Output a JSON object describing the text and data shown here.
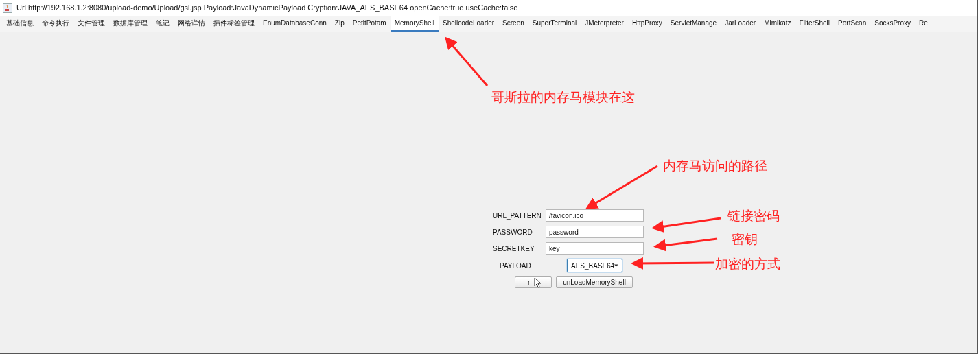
{
  "window": {
    "title": "Url:http://192.168.1.2:8080/upload-demo/Upload/gsl.jsp Payload:JavaDynamicPayload Cryption:JAVA_AES_BASE64 openCache:true useCache:false"
  },
  "tabs": [
    {
      "label": "基础信息",
      "selected": false
    },
    {
      "label": "命令执行",
      "selected": false
    },
    {
      "label": "文件管理",
      "selected": false
    },
    {
      "label": "数据库管理",
      "selected": false
    },
    {
      "label": "笔记",
      "selected": false
    },
    {
      "label": "网络详情",
      "selected": false
    },
    {
      "label": "插件标签管理",
      "selected": false
    },
    {
      "label": "EnumDatabaseConn",
      "selected": false
    },
    {
      "label": "Zip",
      "selected": false
    },
    {
      "label": "PetitPotam",
      "selected": false
    },
    {
      "label": "MemoryShell",
      "selected": true
    },
    {
      "label": "ShellcodeLoader",
      "selected": false
    },
    {
      "label": "Screen",
      "selected": false
    },
    {
      "label": "SuperTerminal",
      "selected": false
    },
    {
      "label": "JMeterpreter",
      "selected": false
    },
    {
      "label": "HttpProxy",
      "selected": false
    },
    {
      "label": "ServletManage",
      "selected": false
    },
    {
      "label": "JarLoader",
      "selected": false
    },
    {
      "label": "Mimikatz",
      "selected": false
    },
    {
      "label": "FilterShell",
      "selected": false
    },
    {
      "label": "PortScan",
      "selected": false
    },
    {
      "label": "SocksProxy",
      "selected": false
    },
    {
      "label": "Re",
      "selected": false
    }
  ],
  "form": {
    "fields": [
      {
        "label": "URL_PATTERN",
        "value": "/favicon.ico"
      },
      {
        "label": "PASSWORD",
        "value": "password"
      },
      {
        "label": "SECRETKEY",
        "value": "key"
      }
    ],
    "payload": {
      "label": "PAYLOAD",
      "value": "AES_BASE64"
    },
    "buttons": [
      "r",
      "unLoadMemoryShell"
    ]
  },
  "annotations": [
    "哥斯拉的内存马模块在这",
    "内存马访问的路径",
    "链接密码",
    "密钥",
    "加密的方式"
  ]
}
